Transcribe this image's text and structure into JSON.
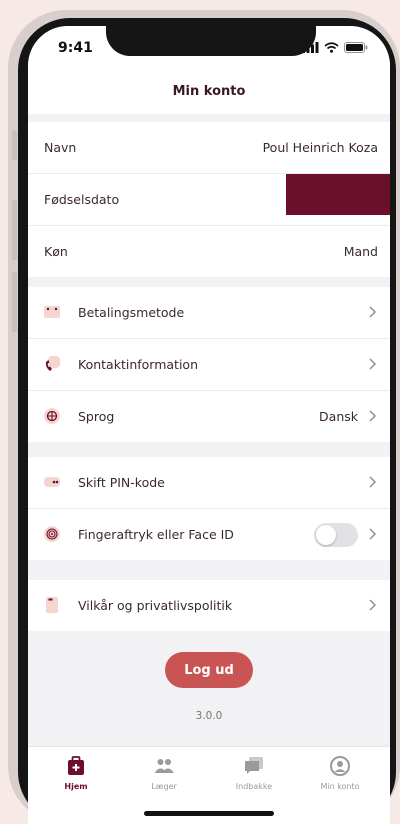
{
  "status_bar": {
    "time": "9:41"
  },
  "header": {
    "title": "Min konto"
  },
  "profile": {
    "name_label": "Navn",
    "name_value": "Poul Heinrich Koza",
    "birth_label": "Fødselsdato",
    "gender_label": "Køn",
    "gender_value": "Mand"
  },
  "settings": {
    "payment_label": "Betalingsmetode",
    "contact_label": "Kontaktinformation",
    "language_label": "Sprog",
    "language_value": "Dansk",
    "pin_label": "Skift PIN-kode",
    "biometric_label": "Fingeraftryk eller Face ID",
    "biometric_enabled": false,
    "terms_label": "Vilkår og privatlivspolitik"
  },
  "logout_label": "Log ud",
  "version": "3.0.0",
  "tabs": [
    {
      "label": "Hjem",
      "icon": "medical-bag-icon",
      "active": true
    },
    {
      "label": "Læger",
      "icon": "people-icon",
      "active": false
    },
    {
      "label": "Indbakke",
      "icon": "inbox-icon",
      "active": false
    },
    {
      "label": "Min konto",
      "icon": "account-icon",
      "active": false
    }
  ],
  "colors": {
    "accent": "#6b0f2a",
    "logout": "#c95454",
    "icon_bg": "#f6d4d0"
  }
}
